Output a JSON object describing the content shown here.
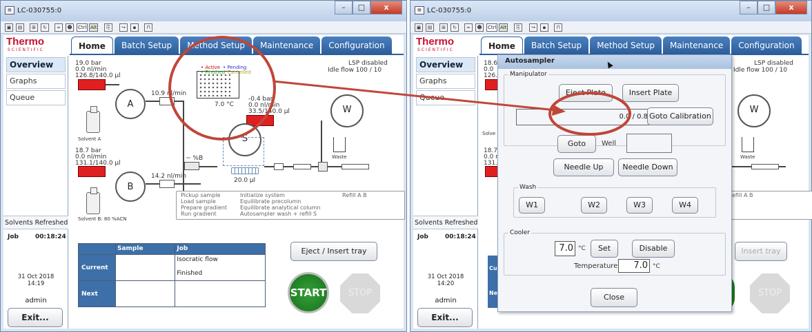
{
  "window_title": "LC-030755:0",
  "window_controls": {
    "minimize": "–",
    "maximize": "□",
    "close": "x"
  },
  "toolbar": {
    "ctrl": "Ctrl",
    "alt": "Alt"
  },
  "logo": {
    "brand": "Thermo",
    "sub": "SCIENTIFIC"
  },
  "tabs": [
    "Home",
    "Batch Setup",
    "Method Setup",
    "Maintenance",
    "Configuration"
  ],
  "sidebar": {
    "items": [
      "Overview",
      "Graphs",
      "Queue"
    ],
    "solvents_refreshed": "Solvents Refreshed",
    "exit": "Exit...",
    "user": "admin",
    "job_label": "Job"
  },
  "left": {
    "lsp_status": "LSP disabled",
    "idle_flow": "Idle flow 100 / 10",
    "pumpA": {
      "label": "A",
      "pressure": "19.0 bar",
      "flow": "0.0 nl/min",
      "volume": "126.8/140.0 µl",
      "flow2": "10.9 nl/min",
      "solvent": "Solvent A"
    },
    "pumpB": {
      "label": "B",
      "pressure": "18.7 bar",
      "flow": "0.0 nl/min",
      "volume": "131.1/140.0 µl",
      "flow2": "14.2 nl/min",
      "solvent": "Solvent B: 80 %ACN"
    },
    "pumpS": {
      "label": "S",
      "pressure": "-0.4 bar",
      "flow": "0.0 nl/min",
      "volume": "33.5/140.0 µl"
    },
    "pumpW": {
      "label": "W",
      "waste": "Waste"
    },
    "percent_b": "~ %B",
    "loop_volume": "20.0 µl",
    "tray": {
      "temp": "7.0 °C",
      "legend": {
        "active": "• Active",
        "pending": "• Pending",
        "finished": "• Finished",
        "cancelled": "• Cancelled"
      }
    },
    "method_steps": {
      "col1": [
        "Pickup sample",
        "Load sample",
        "Prepare gradient",
        "Run gradient"
      ],
      "col2": [
        "Initialize system",
        "Equilibrate precolumn",
        "Equilibrate analytical column",
        "Autosampler wash + refill S"
      ],
      "refill": "Refill A B"
    },
    "job_time": "00:18:24",
    "date": "31 Oct 2018",
    "time": "14:19",
    "table": {
      "headers": [
        "Sample",
        "Job"
      ],
      "rows": [
        {
          "label": "Current",
          "sample": "",
          "job": "Isocratic flow",
          "job2": "Finished"
        },
        {
          "label": "Next",
          "sample": "",
          "job": ""
        }
      ]
    },
    "eject_button": "Eject / Insert tray",
    "start": "START",
    "stop": "STOP"
  },
  "right": {
    "lsp_status": "LSP disabled",
    "idle_flow": "Idle flow 100 / 10",
    "pressure": "18.6",
    "flow": "0.0",
    "volume": "126.8",
    "pressureB": "18.7",
    "flowB": "0.0 nl",
    "volumeB": "131.1",
    "solvent_partial": "Solve",
    "queue_partial": "Queue",
    "waste": "Waste",
    "refill": "efill A B",
    "job_time": "00:18:24",
    "date": "31 Oct 2018",
    "time": "14:20",
    "insert_tray": "Insert tray",
    "stop": "STOP",
    "row_cur_partial": "Cu",
    "row_next_partial": "Nex"
  },
  "autosampler": {
    "title": "Autosampler",
    "manipulator": "Manipulator",
    "eject_plate": "Eject Plate",
    "insert_plate": "Insert Plate",
    "coord_text": "0.0 / 0.8",
    "goto_calibration": "Goto Calibration",
    "goto": "Goto",
    "well": "Well",
    "well_value": "",
    "needle_up": "Needle Up",
    "needle_down": "Needle Down",
    "wash": "Wash",
    "w_buttons": [
      "W1",
      "W2",
      "W3",
      "W4"
    ],
    "cooler": "Cooler",
    "set_temp": "7.0",
    "unit": "°C",
    "set": "Set",
    "disable": "Disable",
    "temperature_label": "Temperature:",
    "temperature_value": "7.0",
    "close": "Close"
  }
}
